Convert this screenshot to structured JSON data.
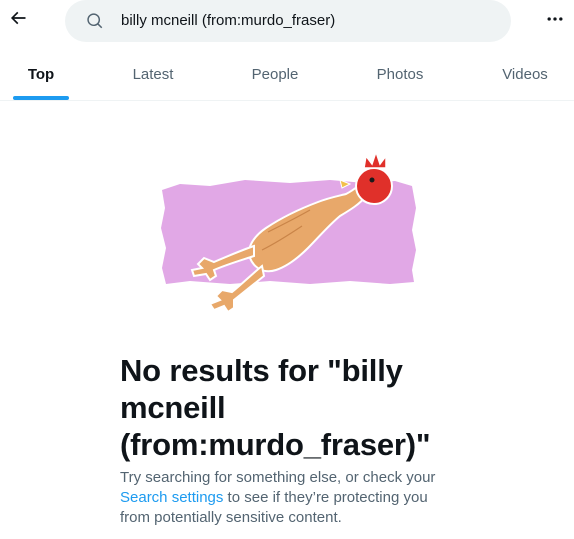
{
  "header": {
    "back_icon": "arrow-left-icon",
    "search_icon": "search-icon",
    "search_value": "billy mcneill (from:murdo_fraser)",
    "more_icon": "more-horizontal-icon"
  },
  "tabs": [
    {
      "label": "Top",
      "active": true
    },
    {
      "label": "Latest",
      "active": false
    },
    {
      "label": "People",
      "active": false
    },
    {
      "label": "Photos",
      "active": false
    },
    {
      "label": "Videos",
      "active": false
    }
  ],
  "empty_state": {
    "illustration": "rubber-chicken-illustration",
    "title": "No results for \"billy mcneill (from:murdo_fraser)\"",
    "desc_before": "Try searching for something else, or check your ",
    "desc_link": "Search settings",
    "desc_after": " to see if they’re protecting you from potentially sensitive content."
  },
  "colors": {
    "accent": "#1d9bf0",
    "text_primary": "#0f1419",
    "text_secondary": "#536471",
    "search_bg": "#eff3f4",
    "illustration_bg": "#e1a8e6",
    "chicken_body": "#e8a86a",
    "chicken_comb": "#e0302a"
  }
}
